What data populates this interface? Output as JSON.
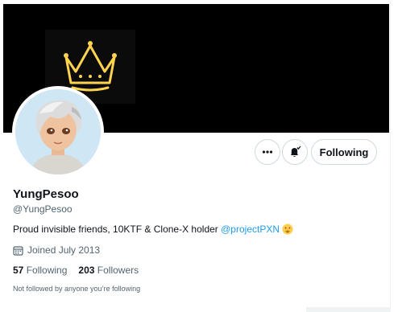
{
  "profile": {
    "display_name": "YungPesoo",
    "handle": "@YungPesoo",
    "bio_text": "Proud invisible friends, 10KTF & Clone-X holder ",
    "bio_mention": "@projectPXN",
    "joined": "Joined July 2013",
    "following_count": "57",
    "following_label": "Following",
    "followers_count": "203",
    "followers_label": "Followers",
    "not_followed": "Not followed by anyone you’re following"
  },
  "actions": {
    "following_button": "Following"
  },
  "icons": {
    "more": "more-icon",
    "notify": "bell-notification-icon",
    "calendar": "calendar-icon",
    "emoji": "shushing-face-emoji",
    "crown": "neon-crown"
  },
  "colors": {
    "accent": "#1d9bf0",
    "banner": "#000000",
    "crown_neon": "#ffd34d"
  }
}
